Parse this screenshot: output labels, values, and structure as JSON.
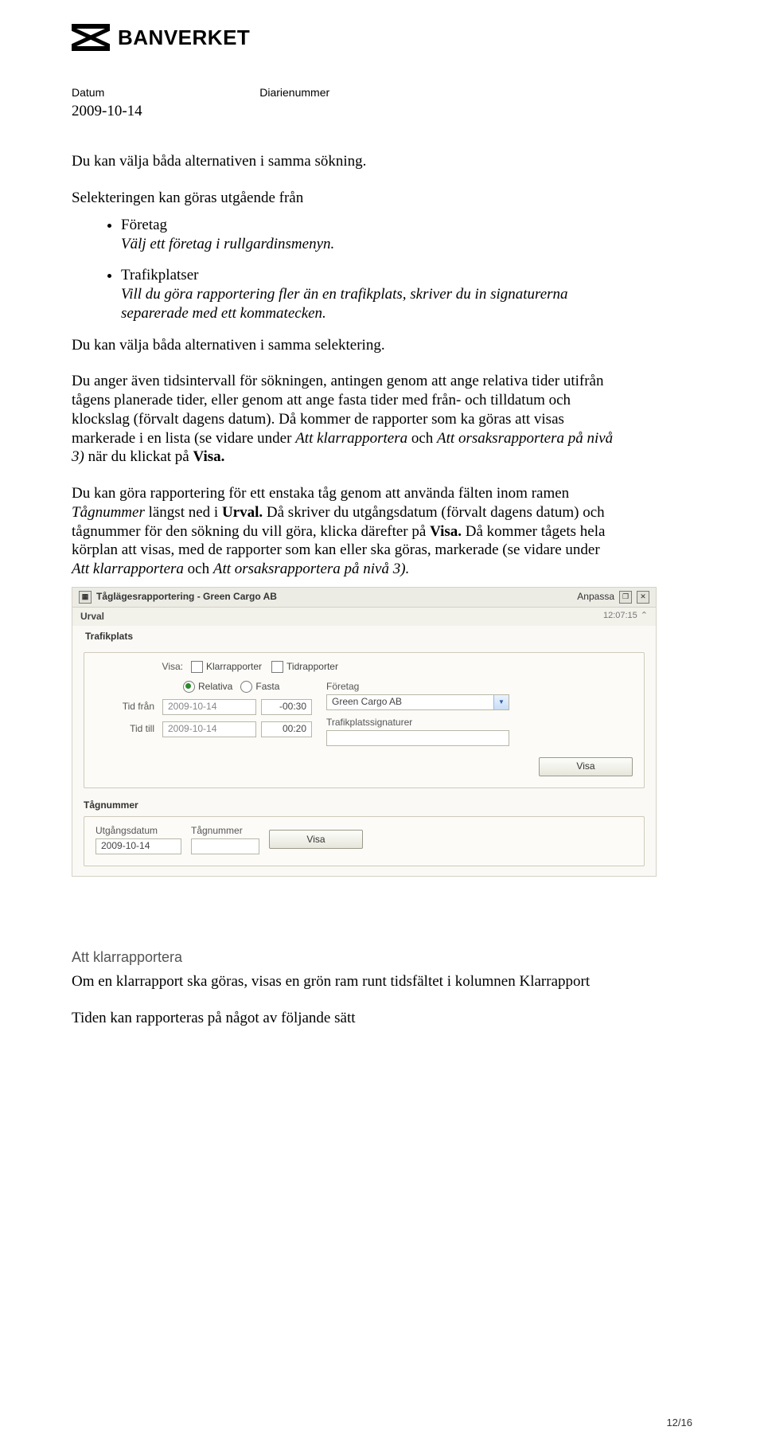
{
  "header": {
    "logo_text": "BANVERKET",
    "datum_label": "Datum",
    "datum_value": "2009-10-14",
    "diarie_label": "Diarienummer"
  },
  "body": {
    "p1": "Du kan välja båda alternativen i samma sökning.",
    "p2": "Selekteringen kan göras utgående från",
    "bullets": [
      {
        "title": "Företag",
        "sub_ital": "Välj ett företag i rullgardinsmenyn."
      },
      {
        "title": "Trafikplatser",
        "sub_ital": "Vill du göra rapportering fler än en trafikplats, skriver du in signaturerna separerade med ett kommatecken."
      }
    ],
    "p3": "Du kan välja båda alternativen i samma selektering.",
    "p4_a": "Du anger även tidsintervall för sökningen, antingen genom att ange relativa tider utifrån tågens planerade tider, eller genom att ange fasta tider med från- och tilldatum och klockslag (förvalt dagens datum). Då kommer de rapporter som ka göras att visas markerade i en lista (se vidare under ",
    "p4_i1": "Att klarrapportera",
    "p4_b": " och ",
    "p4_i2": "Att orsaksrapportera på nivå 3)",
    "p4_c": " när du klickat på ",
    "p4_bold": "Visa.",
    "p5_a": "Du kan göra rapportering för ett enstaka tåg genom att använda fälten inom ramen ",
    "p5_i1": "Tågnummer",
    "p5_b": " längst ned i ",
    "p5_bold1": "Urval.",
    "p5_c": " Då skriver du utgångsdatum (förvalt dagens datum) och tågnummer för den sökning du vill göra, klicka därefter på ",
    "p5_bold2": "Visa.",
    "p5_d": " Då kommer tågets hela körplan att visas, med de rapporter som kan eller ska göras, markerade (se vidare under ",
    "p5_i2": "Att klarrapportera",
    "p5_e": " och ",
    "p5_i3": "Att orsaksrapportera på nivå 3).",
    "h2": "Att klarrapportera",
    "p6": "Om en klarrapport ska göras, visas en grön ram runt tidsfältet i kolumnen Klarrapport",
    "p7": "Tiden kan rapporteras på något av följande sätt"
  },
  "shot": {
    "title": "Tåglägesrapportering - Green Cargo AB",
    "anpassa": "Anpassa",
    "urval": "Urval",
    "clock": "12:07:15",
    "trafikplats": "Trafikplats",
    "visa_lbl": "Visa:",
    "chk_klar": "Klarrapporter",
    "chk_tid": "Tidrapporter",
    "rdo_rel": "Relativa",
    "rdo_fast": "Fasta",
    "tid_fran": "Tid från",
    "tid_till": "Tid till",
    "date1": "2009-10-14",
    "time1": "-00:30",
    "date2": "2009-10-14",
    "time2": "00:20",
    "foretag_lbl": "Företag",
    "foretag_val": "Green Cargo AB",
    "trafiksig_lbl": "Trafikplatssignaturer",
    "btn_visa": "Visa",
    "tagnummer": "Tågnummer",
    "utg_lbl": "Utgångsdatum",
    "tag_lbl": "Tågnummer",
    "utg_val": "2009-10-14",
    "btn_visa2": "Visa"
  },
  "footer": {
    "page": "12/16"
  }
}
